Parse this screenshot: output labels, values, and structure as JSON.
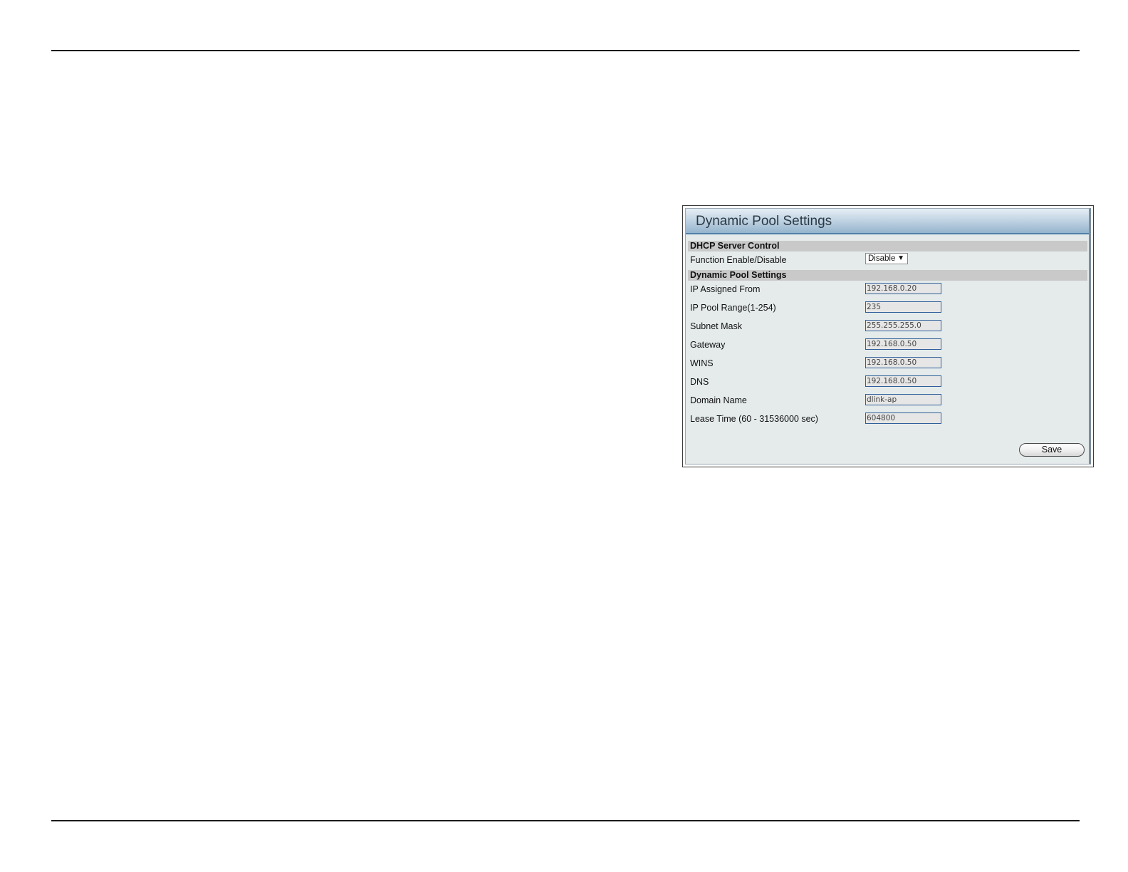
{
  "panel": {
    "title": "Dynamic Pool Settings"
  },
  "dhcp_section": {
    "title": "DHCP Server Control",
    "function_label": "Function Enable/Disable",
    "function_value": "Disable"
  },
  "pool_section": {
    "title": "Dynamic Pool Settings",
    "fields": [
      {
        "label": "IP Assigned From",
        "value": "192.168.0.20"
      },
      {
        "label": "IP Pool Range(1-254)",
        "value": "235"
      },
      {
        "label": "Subnet Mask",
        "value": "255.255.255.0"
      },
      {
        "label": "Gateway",
        "value": "192.168.0.50"
      },
      {
        "label": "WINS",
        "value": "192.168.0.50"
      },
      {
        "label": "DNS",
        "value": "192.168.0.50"
      },
      {
        "label": "Domain Name",
        "value": "dlink-ap"
      },
      {
        "label": "Lease Time (60 - 31536000 sec)",
        "value": "604800"
      }
    ]
  },
  "actions": {
    "save_label": "Save"
  },
  "icons": {
    "select_arrow": "triangle-down-icon"
  }
}
